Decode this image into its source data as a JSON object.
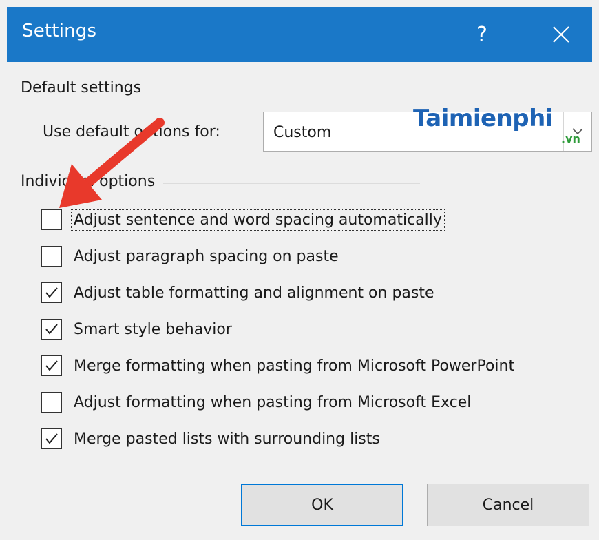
{
  "window": {
    "title": "Settings",
    "help_label": "?",
    "close_label": "✕"
  },
  "default_settings": {
    "heading": "Default settings",
    "use_default_label": "Use default options for:",
    "selected_value": "Custom"
  },
  "individual_options": {
    "heading": "Individual options",
    "items": [
      {
        "label": "Adjust sentence and word spacing automatically",
        "checked": false
      },
      {
        "label": "Adjust paragraph spacing on paste",
        "checked": false
      },
      {
        "label": "Adjust table formatting and alignment on paste",
        "checked": true
      },
      {
        "label": "Smart style behavior",
        "checked": true
      },
      {
        "label": "Merge formatting when pasting from Microsoft PowerPoint",
        "checked": true
      },
      {
        "label": "Adjust formatting when pasting from Microsoft Excel",
        "checked": false
      },
      {
        "label": "Merge pasted lists with surrounding lists",
        "checked": true
      }
    ]
  },
  "buttons": {
    "ok_label": "OK",
    "cancel_label": "Cancel"
  },
  "watermark": {
    "brand": "Taimienphi",
    "suffix": ".vn"
  },
  "colors": {
    "titlebar": "#1a78c8",
    "annotation_arrow": "#e8392b",
    "brand": "#1e63b4"
  },
  "icons": {
    "help": "question-mark-icon",
    "close": "close-icon",
    "dropdown": "chevron-down-icon",
    "check": "checkmark-icon",
    "annotation": "red-arrow-icon"
  }
}
